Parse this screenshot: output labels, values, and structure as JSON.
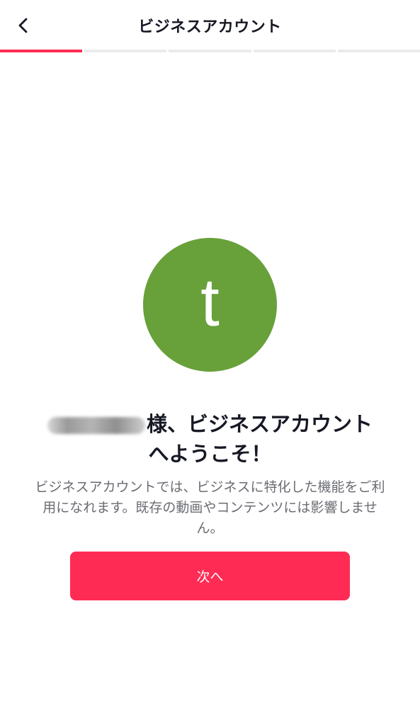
{
  "header": {
    "title": "ビジネスアカウント",
    "back_icon": "chevron-left-icon"
  },
  "progress": {
    "total_steps": 5,
    "current_step": 1,
    "active_color": "#fe2c55",
    "inactive_color": "#ebebeb"
  },
  "avatar": {
    "letter": "t",
    "color": "#68a03a"
  },
  "welcome": {
    "username_redacted": true,
    "line1": "様、ビジネスアカウント",
    "line2": "へようこそ！"
  },
  "description": {
    "text": "ビジネスアカウントでは、ビジネスに特化した機能をご利用になれます。既存の動画やコンテンツには影響しません。"
  },
  "next_button": {
    "label": "次へ",
    "color": "#fe2c55"
  }
}
